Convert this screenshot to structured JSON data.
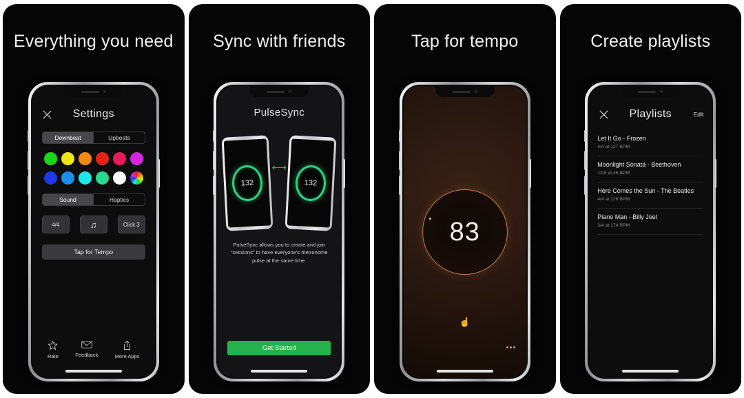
{
  "panels": [
    {
      "headline": "Everything you need",
      "screen": {
        "close_icon": "close-icon",
        "title": "Settings",
        "beat_segment": {
          "options": [
            "Downbeat",
            "Upbeats"
          ],
          "selected": "Downbeat"
        },
        "colors": [
          "#19d618",
          "#f2e517",
          "#f28a10",
          "#e62216",
          "#e81a5e",
          "#d327e0",
          "#1e38e8",
          "#1a8ff0",
          "#1fe8e8",
          "#27d98d",
          "#ffffff",
          "rainbow"
        ],
        "output_segment": {
          "options": [
            "Sound",
            "Haptics"
          ],
          "selected": "Sound"
        },
        "controls": [
          {
            "name": "time-signature",
            "label": "4/4"
          },
          {
            "name": "sound-note",
            "label": "♫"
          },
          {
            "name": "click-sound",
            "label": "Click 3"
          }
        ],
        "tap_button": "Tap for Tempo",
        "footer": [
          {
            "icon": "star-icon",
            "label": "Rate"
          },
          {
            "icon": "envelope-icon",
            "label": "Feedback"
          },
          {
            "icon": "share-icon",
            "label": "More Apps"
          }
        ]
      }
    },
    {
      "headline": "Sync with friends",
      "screen": {
        "title": "PulseSync",
        "device_bpm_left": "132",
        "device_bpm_right": "132",
        "sync_icon": "sync-icon",
        "description": "PulseSync allows you to create and join “sessions” to have everyone's metronome pulse at the same time.",
        "cta": "Get Started",
        "cta_color": "#24b24c",
        "ring_color": "#2bd67f"
      }
    },
    {
      "headline": "Tap for tempo",
      "screen": {
        "bpm": "83",
        "ring_color": "#c97b4a",
        "tap_icon": "tap-hand-icon",
        "more_icon": "more-dots-icon"
      }
    },
    {
      "headline": "Create playlists",
      "screen": {
        "close_icon": "close-icon",
        "title": "Playlists",
        "edit_label": "Edit",
        "items": [
          {
            "name": "Let It Go - Frozen",
            "meta": "4/4 at 127 BPM"
          },
          {
            "name": "Moonlight Sonata - Beethoven",
            "meta": "12/8 at 46 BPM"
          },
          {
            "name": "Here Comes the Sun - The Beatles",
            "meta": "4/4 at 126 BPM"
          },
          {
            "name": "Piano Man - Billy Joel",
            "meta": "3/4 at 174 BPM"
          }
        ]
      }
    }
  ]
}
